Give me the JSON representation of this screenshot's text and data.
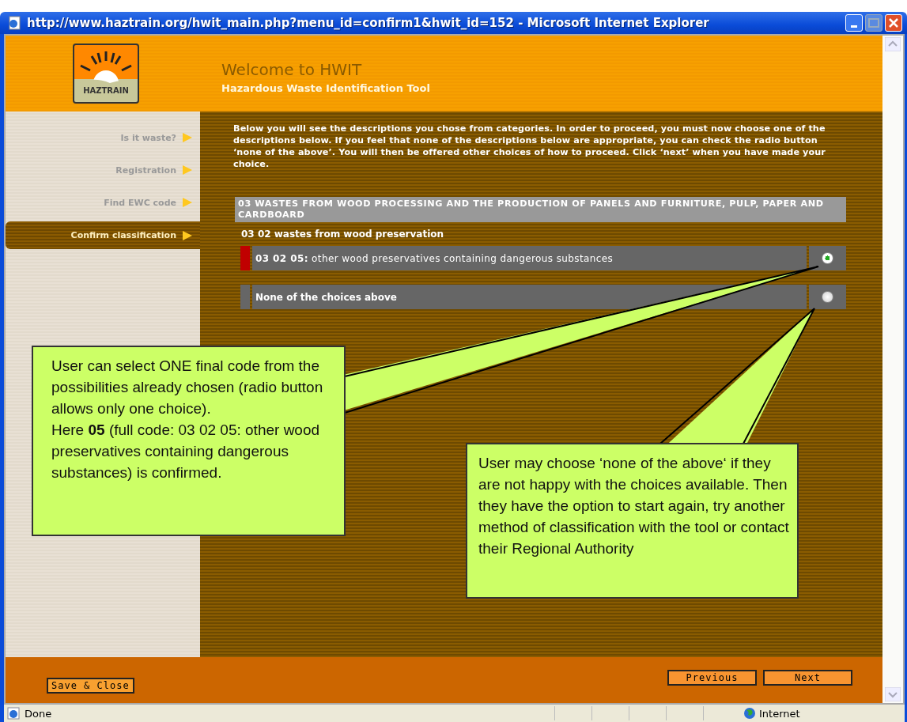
{
  "window": {
    "title": "http://www.haztrain.org/hwit_main.php?menu_id=confirm1&hwit_id=152 - Microsoft Internet Explorer"
  },
  "header": {
    "logo_text": "HAZTRAIN",
    "title": "Welcome to HWIT",
    "subtitle": "Hazardous Waste Identification Tool"
  },
  "sidebar": {
    "items": [
      {
        "label": "Is it waste?",
        "selected": false
      },
      {
        "label": "Registration",
        "selected": false
      },
      {
        "label": "Find EWC code",
        "selected": false
      },
      {
        "label": "Confirm classification",
        "selected": true
      }
    ]
  },
  "instructions": "Below you will see the descriptions you chose from categories. In order to proceed, you must now choose one of the descriptions below. If you feel that none of the descriptions below are appropriate, you can check the radio button ‘none of the above’. You will then be offered other choices of how to proceed. Click ‘next’ when you have made your choice.",
  "category": "03 WASTES FROM WOOD PROCESSING AND THE PRODUCTION OF PANELS AND FURNITURE, PULP, PAPER AND CARDBOARD",
  "subcategory": "03 02 wastes from wood preservation",
  "choices": [
    {
      "kind": "code",
      "label": "**03 02 05:** other wood preservatives containing dangerous substances",
      "hazardous": true,
      "selected": true
    },
    {
      "kind": "none",
      "label": "None of the choices above",
      "hazardous": false,
      "selected": false
    }
  ],
  "footer": {
    "left_button": "Save & Close",
    "right_buttons": [
      "Previous",
      "Next"
    ]
  },
  "status_bar": {
    "status": "Done",
    "zone": "Internet"
  },
  "callouts": [
    {
      "paragraphs": [
        "User can select ONE final code from the possibilities already chosen (radio button allows only one choice).",
        "Here **05** (full code: 03 02 05: other wood preservatives containing dangerous substances) is confirmed."
      ]
    },
    {
      "paragraphs": [
        "User may choose ‘none of the above‘ if they are not happy with the choices available. Then they have the option to start again, try another method of classification with the tool or contact their Regional Authority"
      ]
    }
  ]
}
